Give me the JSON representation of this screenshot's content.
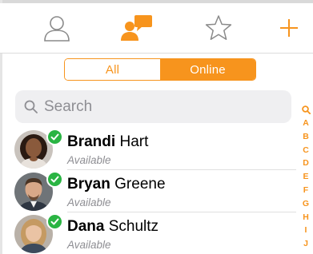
{
  "colors": {
    "accent": "#f7941d",
    "online_status": "#2ab443",
    "tab_icon_gray": "#8a8a8a"
  },
  "tabbar": {
    "tabs": [
      {
        "icon": "person-icon",
        "active": false
      },
      {
        "icon": "chat-bubbles-icon",
        "active": true
      },
      {
        "icon": "star-icon",
        "active": false
      }
    ],
    "add_icon": "plus-icon"
  },
  "segment": {
    "all_label": "All",
    "online_label": "Online",
    "selected": "Online"
  },
  "search": {
    "placeholder": "Search",
    "value": ""
  },
  "index": [
    "A",
    "B",
    "C",
    "D",
    "E",
    "F",
    "G",
    "H",
    "I",
    "J"
  ],
  "contacts": [
    {
      "first": "Brandi",
      "last": "Hart",
      "status": "Available",
      "avatar": "avatar-brandi"
    },
    {
      "first": "Bryan",
      "last": "Greene",
      "status": "Available",
      "avatar": "avatar-bryan"
    },
    {
      "first": "Dana",
      "last": "Schultz",
      "status": "Available",
      "avatar": "avatar-dana"
    }
  ]
}
